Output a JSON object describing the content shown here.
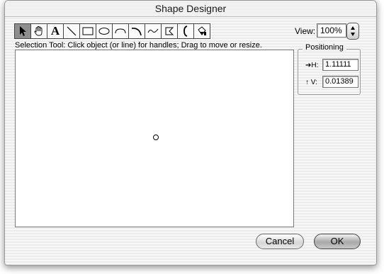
{
  "window": {
    "title": "Shape Designer"
  },
  "toolbar": {
    "tools": [
      {
        "icon": "arrow-pointer-icon",
        "selected": true
      },
      {
        "icon": "hand-icon"
      },
      {
        "icon": "text-icon",
        "glyph": "A"
      },
      {
        "icon": "line-icon"
      },
      {
        "icon": "rectangle-icon"
      },
      {
        "icon": "oval-icon"
      },
      {
        "icon": "arc-icon"
      },
      {
        "icon": "curve-icon"
      },
      {
        "icon": "freehand-icon"
      },
      {
        "icon": "polygon-icon"
      },
      {
        "icon": "bracket-icon"
      },
      {
        "icon": "fill-bucket-icon"
      }
    ]
  },
  "view": {
    "label": "View:",
    "zoom": "100%"
  },
  "hint": {
    "text": "Selection Tool: Click object (or line) for handles; Drag to move or resize."
  },
  "positioning": {
    "title": "Positioning",
    "h_label": "➔H:",
    "h_value": "1.11111",
    "v_label": "↑ V:",
    "v_value": "0.01389"
  },
  "buttons": {
    "cancel": "Cancel",
    "ok": "OK"
  }
}
